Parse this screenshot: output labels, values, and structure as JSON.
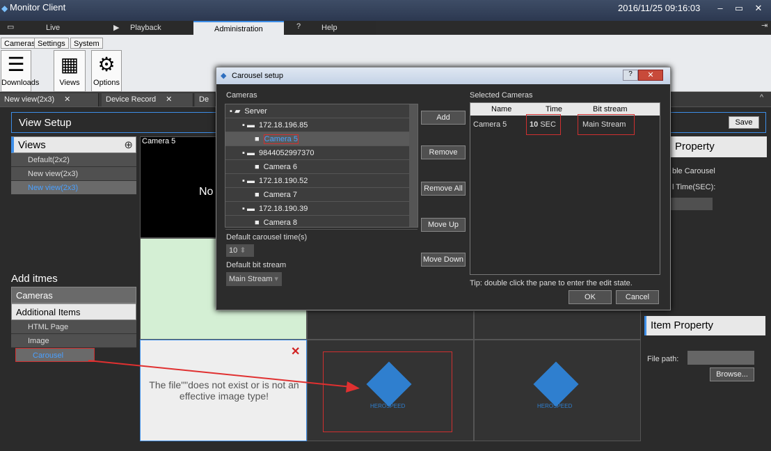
{
  "window": {
    "title": "Monitor Client",
    "clock": "2016/11/25 09:16:03"
  },
  "menu": [
    {
      "label": "Live"
    },
    {
      "label": "Playback"
    },
    {
      "label": "Administration"
    },
    {
      "label": "Help"
    }
  ],
  "ribbon": {
    "tabs": [
      "Cameras",
      "Settings",
      "System"
    ],
    "buttons": [
      "Downloads",
      "Views",
      "Options"
    ]
  },
  "doc_tabs": [
    "New view(2x3)",
    "Device Record",
    "De"
  ],
  "view_setup": {
    "title": "View Setup",
    "save": "Save"
  },
  "views": {
    "title": "Views",
    "items": [
      "Default(2x2)",
      "New view(2x3)",
      "New view(2x3)"
    ]
  },
  "add_items": {
    "title": "Add itmes",
    "cameras": "Cameras",
    "additional": "Additional Items",
    "items": [
      "HTML Page",
      "Image",
      "Carousel"
    ]
  },
  "panes": {
    "camera5": "Camera 5",
    "no_text": "No",
    "error": "The file\"\"does not exist or is not an effective image type!",
    "logo": "HEROSPEED"
  },
  "view_property": {
    "title": "Property",
    "enable": "ble Carousel",
    "time": "l Time(SEC):"
  },
  "item_property": {
    "title": "Item Property",
    "file_path": "File path:",
    "browse": "Browse..."
  },
  "dialog": {
    "title": "Carousel setup",
    "cameras_label": "Cameras",
    "tree": [
      {
        "label": "Server",
        "level": 0
      },
      {
        "label": "172.18.196.85",
        "level": 1
      },
      {
        "label": "Camera 5",
        "level": 2
      },
      {
        "label": "9844052997370",
        "level": 1
      },
      {
        "label": "Camera 6",
        "level": 2
      },
      {
        "label": "172.18.190.52",
        "level": 1
      },
      {
        "label": "Camera 7",
        "level": 2
      },
      {
        "label": "172.18.190.39",
        "level": 1
      },
      {
        "label": "Camera 8",
        "level": 2
      }
    ],
    "default_time_label": "Default carousel time(s)",
    "default_time": "10",
    "default_bit_label": "Default bit stream",
    "default_bit": "Main Stream",
    "buttons": [
      "Add",
      "Remove",
      "Remove All",
      "Move Up",
      "Move Down"
    ],
    "selected_label": "Selected Cameras",
    "columns": [
      "Name",
      "Time",
      "Bit stream"
    ],
    "rows": [
      {
        "name": "Camera 5",
        "time": "10",
        "unit": "SEC",
        "stream": "Main Stream"
      }
    ],
    "tip": "Tip: double click the pane to enter the edit state.",
    "ok": "OK",
    "cancel": "Cancel"
  }
}
